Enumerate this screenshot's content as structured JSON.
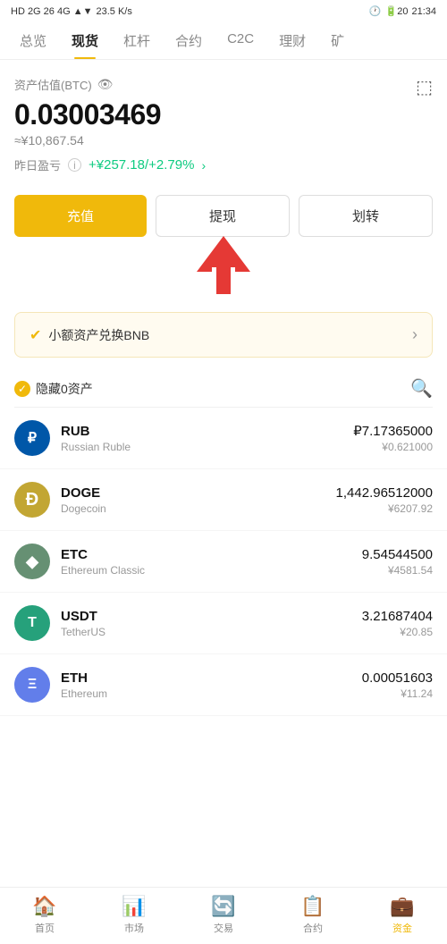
{
  "statusBar": {
    "left": "HD 2G 26 4G",
    "network": "23.5 K/s",
    "time": "21:34",
    "battery": "20"
  },
  "navTabs": {
    "items": [
      "总览",
      "现货",
      "杠杆",
      "合约",
      "C2C",
      "理财",
      "矿"
    ],
    "activeIndex": 1
  },
  "asset": {
    "label": "资产估值(BTC)",
    "btcValue": "0.03003469",
    "cnyApprox": "≈¥10,867.54",
    "pnlLabel": "昨日盈亏",
    "pnlValue": "+¥257.18/+2.79%"
  },
  "buttons": {
    "recharge": "充值",
    "withdraw": "提现",
    "transfer": "划转"
  },
  "convertBanner": {
    "text": "小额资产兑换BNB"
  },
  "assetList": {
    "hideZeroLabel": "隐藏0资产",
    "items": [
      {
        "symbol": "RUB",
        "name": "Russian Ruble",
        "balance": "₽7.17365000",
        "cny": "¥0.621000",
        "logoClass": "logo-rub",
        "logoText": "₽"
      },
      {
        "symbol": "DOGE",
        "name": "Dogecoin",
        "balance": "1,442.96512000",
        "cny": "¥6207.92",
        "logoClass": "logo-doge",
        "logoText": "Ð"
      },
      {
        "symbol": "ETC",
        "name": "Ethereum Classic",
        "balance": "9.54544500",
        "cny": "¥4581.54",
        "logoClass": "logo-etc",
        "logoText": ""
      },
      {
        "symbol": "USDT",
        "name": "TetherUS",
        "balance": "3.21687404",
        "cny": "¥20.85",
        "logoClass": "logo-usdt",
        "logoText": "T"
      },
      {
        "symbol": "ETH",
        "name": "Ethereum",
        "balance": "0.00051603",
        "cny": "¥11.24",
        "logoClass": "logo-eth",
        "logoText": "Ξ"
      }
    ]
  },
  "bottomNav": {
    "items": [
      "首页",
      "市场",
      "交易",
      "合约",
      "资金"
    ],
    "activeIndex": 4
  }
}
